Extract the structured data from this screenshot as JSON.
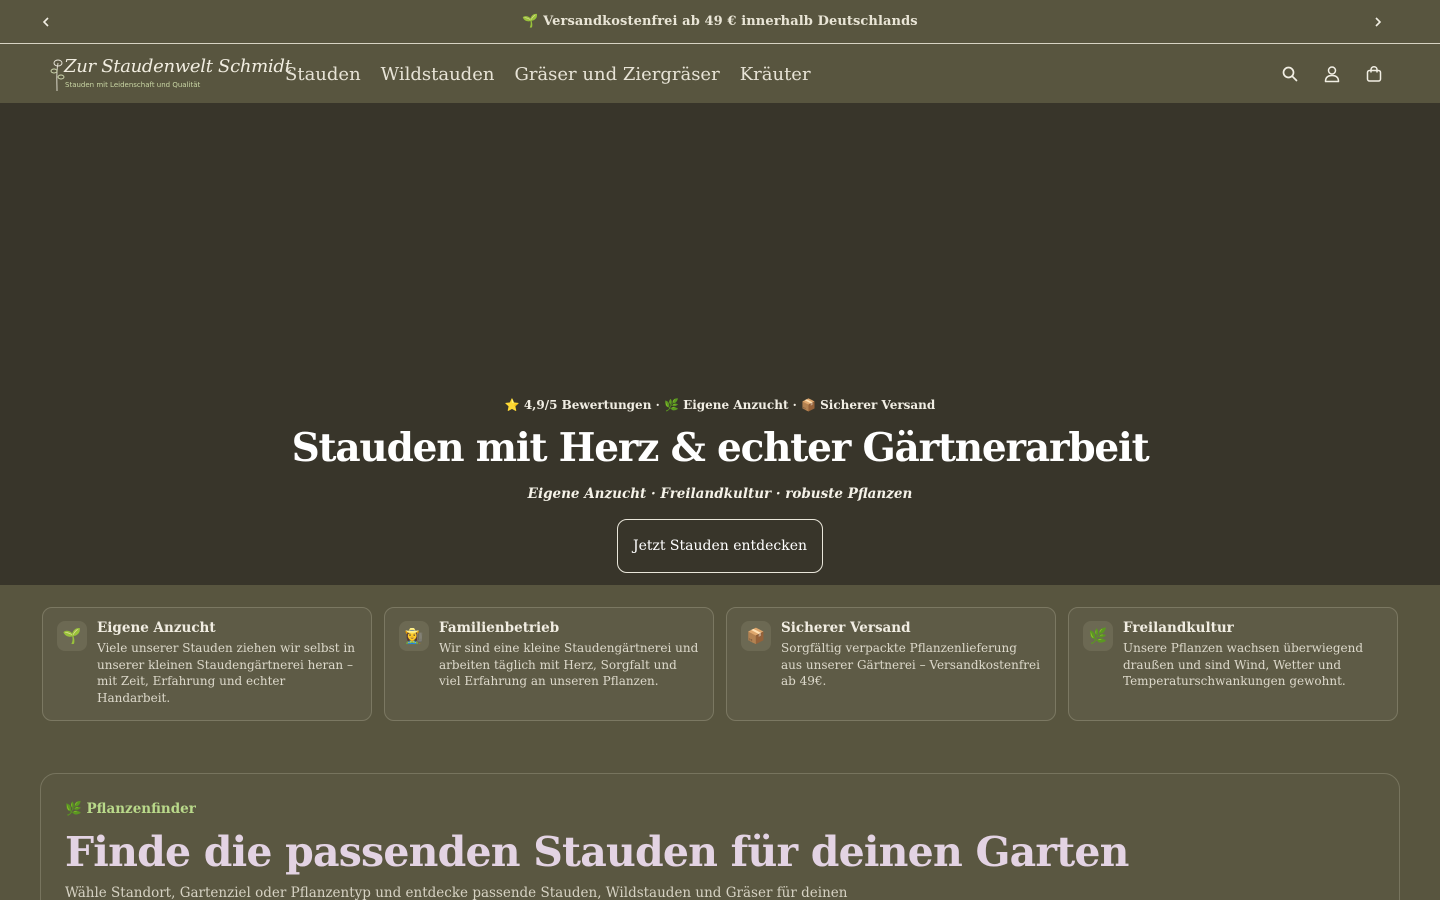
{
  "announcement": {
    "text": "🌱 Versandkostenfrei ab 49 € innerhalb Deutschlands"
  },
  "header": {
    "logo_title": "Zur Staudenwelt Schmidt",
    "logo_subtitle": "Stauden mit Leidenschaft und Qualität",
    "nav": [
      {
        "label": "Stauden"
      },
      {
        "label": "Wildstauden"
      },
      {
        "label": "Gräser und Ziergräser"
      },
      {
        "label": "Kräuter"
      }
    ],
    "icons": [
      "search-icon",
      "account-icon",
      "cart-icon"
    ]
  },
  "hero": {
    "badges": "⭐ 4,9/5 Bewertungen · 🌿 Eigene Anzucht · 📦 Sicherer Versand",
    "title": "Stauden mit Herz & echter Gärtnerarbeit",
    "subtitle": "Eigene Anzucht · Freilandkultur · robuste Pflanzen",
    "cta": "Jetzt Stauden entdecken"
  },
  "features": [
    {
      "icon": "🌱",
      "title": "Eigene Anzucht",
      "text": "Viele unserer Stauden ziehen wir selbst in unserer kleinen Staudengärtnerei heran – mit Zeit, Erfahrung und echter Handarbeit."
    },
    {
      "icon": "👩‍🌾",
      "title": "Familienbetrieb",
      "text": "Wir sind eine kleine Staudengärtnerei und arbeiten täglich mit Herz, Sorgfalt und viel Erfahrung an unseren Pflanzen."
    },
    {
      "icon": "📦",
      "title": "Sicherer Versand",
      "text": "Sorgfältig verpackte Pflanzenlieferung aus unserer Gärtnerei – Versandkostenfrei ab 49€."
    },
    {
      "icon": "🌿",
      "title": "Freilandkultur",
      "text": "Unsere Pflanzen wachsen überwiegend draußen und sind Wind, Wetter und Temperaturschwankungen gewohnt."
    }
  ],
  "finder": {
    "tag": "🌿 Pflanzenfinder",
    "title": "Finde die passenden Stauden für deinen Garten",
    "text": "Wähle Standort, Gartenziel oder Pflanzentyp und entdecke passende Stauden, Wildstauden und Gräser für deinen"
  },
  "colors": {
    "background": "#58553f",
    "hero": "#38352a",
    "accent_green": "#b9d98a",
    "finder_title": "#e3d3e3"
  }
}
